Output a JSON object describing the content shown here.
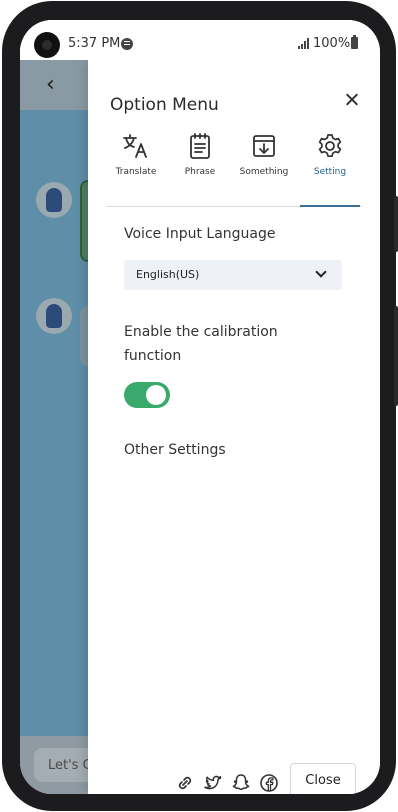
{
  "status_bar": {
    "time": "5:37 PM",
    "battery": "100%"
  },
  "background_app": {
    "input_placeholder": "Let's C"
  },
  "drawer": {
    "title": "Option Menu",
    "tabs": [
      {
        "label": "Translate",
        "icon": "translate-icon"
      },
      {
        "label": "Phrase",
        "icon": "notepad-icon"
      },
      {
        "label": "Something",
        "icon": "archive-download-icon"
      },
      {
        "label": "Setting",
        "icon": "gear-icon",
        "active": true
      }
    ],
    "settings": {
      "voice_input_label": "Voice Input Language",
      "voice_input_value": "English(US)",
      "calibration_label_line1": "Enable the calibration",
      "calibration_label_line2": "function",
      "calibration_enabled": true,
      "other_settings_label": "Other Settings"
    },
    "footer": {
      "icons": [
        "link-icon",
        "twitter-icon",
        "snapchat-icon",
        "facebook-icon"
      ],
      "close_label": "Close"
    }
  },
  "colors": {
    "accent": "#3a6f9c",
    "toggle_on": "#3aaa6c",
    "overlay_bg": "#5e8ea8"
  }
}
